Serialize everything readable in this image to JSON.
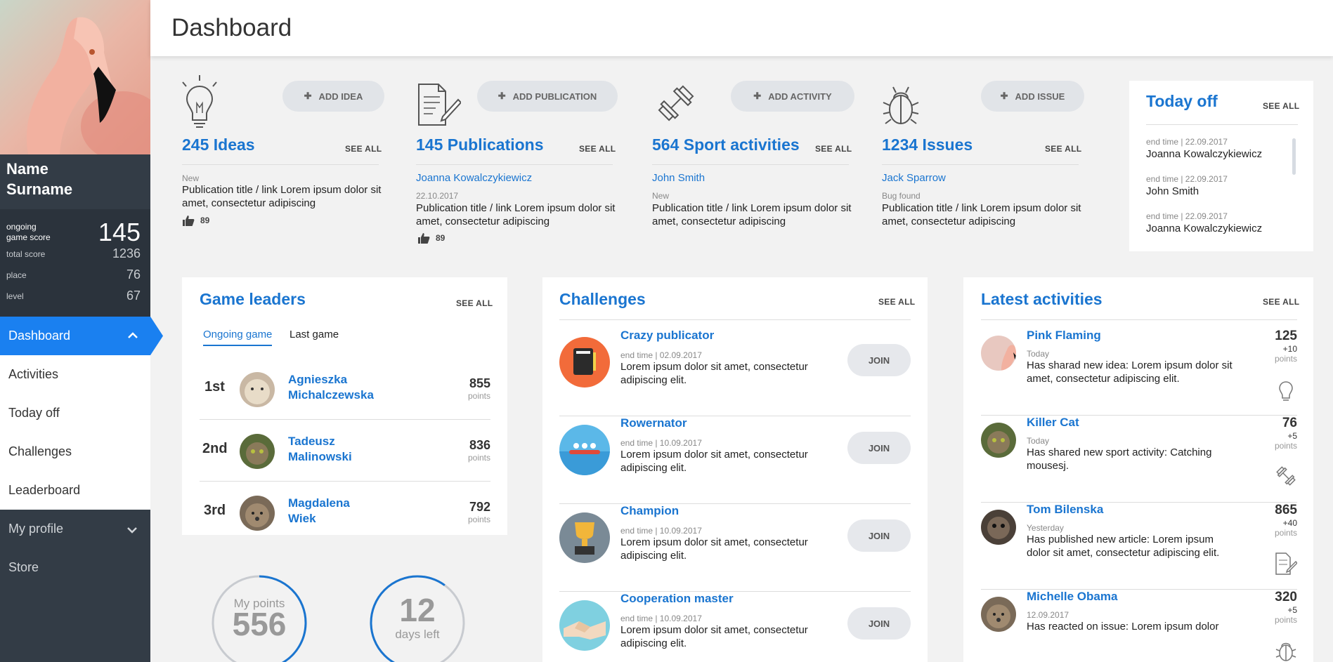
{
  "page_title": "Dashboard",
  "user": {
    "first": "Name",
    "last": "Surname"
  },
  "scores": {
    "ongoing_label_1": "ongoing",
    "ongoing_label_2": "game score",
    "ongoing_value": "145",
    "rows": [
      {
        "label": "total score",
        "value": "1236"
      },
      {
        "label": "place",
        "value": "76"
      },
      {
        "label": "level",
        "value": "67"
      }
    ]
  },
  "nav": {
    "dashboard": "Dashboard",
    "activities": "Activities",
    "today_off": "Today off",
    "challenges": "Challenges",
    "leaderboard": "Leaderboard",
    "my_profile": "My profile",
    "store": "Store"
  },
  "stats": [
    {
      "button": "ADD IDEA",
      "title": "245 Ideas",
      "see_all": "SEE ALL",
      "author": "",
      "meta": "New",
      "text": "Publication title / link  Lorem ipsum dolor sit amet, consectetur adipiscing",
      "likes": "89",
      "icon": "lightbulb-icon"
    },
    {
      "button": "ADD PUBLICATION",
      "title": "145 Publications",
      "see_all": "SEE ALL",
      "author": "Joanna Kowalczykiewicz",
      "meta": "22.10.2017",
      "text": "Publication title / link  Lorem ipsum dolor sit amet, consectetur adipiscing",
      "likes": "89",
      "icon": "document-icon"
    },
    {
      "button": "ADD ACTIVITY",
      "title": "564 Sport activities",
      "see_all": "SEE ALL",
      "author": "John Smith",
      "meta": "New",
      "text": "Publication title / link  Lorem ipsum dolor sit amet, consectetur adipiscing",
      "likes": "",
      "icon": "dumbbell-icon"
    },
    {
      "button": "ADD ISSUE",
      "title": "1234 Issues",
      "see_all": "SEE ALL",
      "author": "Jack Sparrow",
      "meta": "Bug found",
      "text": "Publication title / link  Lorem ipsum dolor sit amet, consectetur adipiscing",
      "likes": "",
      "icon": "bug-icon"
    }
  ],
  "today_off": {
    "title": "Today off",
    "see_all": "SEE ALL",
    "items": [
      {
        "time": "end time | 22.09.2017",
        "name": "Joanna Kowalczykiewicz"
      },
      {
        "time": "end time | 22.09.2017",
        "name": "John Smith"
      },
      {
        "time": "end time | 22.09.2017",
        "name": "Joanna Kowalczykiewicz"
      }
    ]
  },
  "leaders": {
    "title": "Game leaders",
    "see_all": "SEE ALL",
    "tab_ongoing": "Ongoing game",
    "tab_last": "Last game",
    "points_label": "points",
    "rows": [
      {
        "place": "1st",
        "first": "Agnieszka",
        "last": "Michalczewska",
        "points": "855"
      },
      {
        "place": "2nd",
        "first": "Tadeusz",
        "last": "Malinowski",
        "points": "836"
      },
      {
        "place": "3rd",
        "first": "Magdalena",
        "last": "Wiek",
        "points": "792"
      }
    ]
  },
  "gauges": {
    "points_label": "My points",
    "points_value": "556",
    "points_fraction": 0.42,
    "days_value": "12",
    "days_label": "days left",
    "days_fraction": 0.6
  },
  "challenges": {
    "title": "Challenges",
    "see_all": "SEE ALL",
    "join": "JOIN",
    "items": [
      {
        "name": "Crazy publicator",
        "time": "end time | 02.09.2017",
        "text": "Lorem ipsum dolor sit amet, consectetur adipiscing elit.",
        "color": "#f26b3a"
      },
      {
        "name": "Rowernator",
        "time": "end time | 10.09.2017",
        "text": "Lorem ipsum dolor sit amet, consectetur adipiscing elit.",
        "color": "#5bb8e8"
      },
      {
        "name": "Champion",
        "time": "end time | 10.09.2017",
        "text": "Lorem ipsum dolor sit amet, consectetur adipiscing elit.",
        "color": "#7a8a96"
      },
      {
        "name": "Cooperation master",
        "time": "end time | 10.09.2017",
        "text": "Lorem ipsum dolor sit amet, consectetur adipiscing elit.",
        "color": "#7fd0e0"
      }
    ]
  },
  "latest": {
    "title": "Latest activities",
    "see_all": "SEE ALL",
    "points_label": "points",
    "items": [
      {
        "name": "Pink Flaming",
        "when": "Today",
        "text": "Has sharad  new idea: Lorem ipsum dolor sit amet, consectetur adipiscing elit.",
        "score": "125",
        "delta": "+10"
      },
      {
        "name": "Killer Cat",
        "when": "Today",
        "text": "Has shared new sport activity: Catching mousesj.",
        "score": "76",
        "delta": "+5"
      },
      {
        "name": "Tom Bilenska",
        "when": "Yesterday",
        "text": "Has published new article: Lorem ipsum dolor sit amet, consectetur adipiscing elit.",
        "score": "865",
        "delta": "+40"
      },
      {
        "name": "Michelle Obama",
        "when": "12.09.2017",
        "text": "Has reacted on issue: Lorem ipsum dolor",
        "score": "320",
        "delta": "+5"
      }
    ]
  }
}
